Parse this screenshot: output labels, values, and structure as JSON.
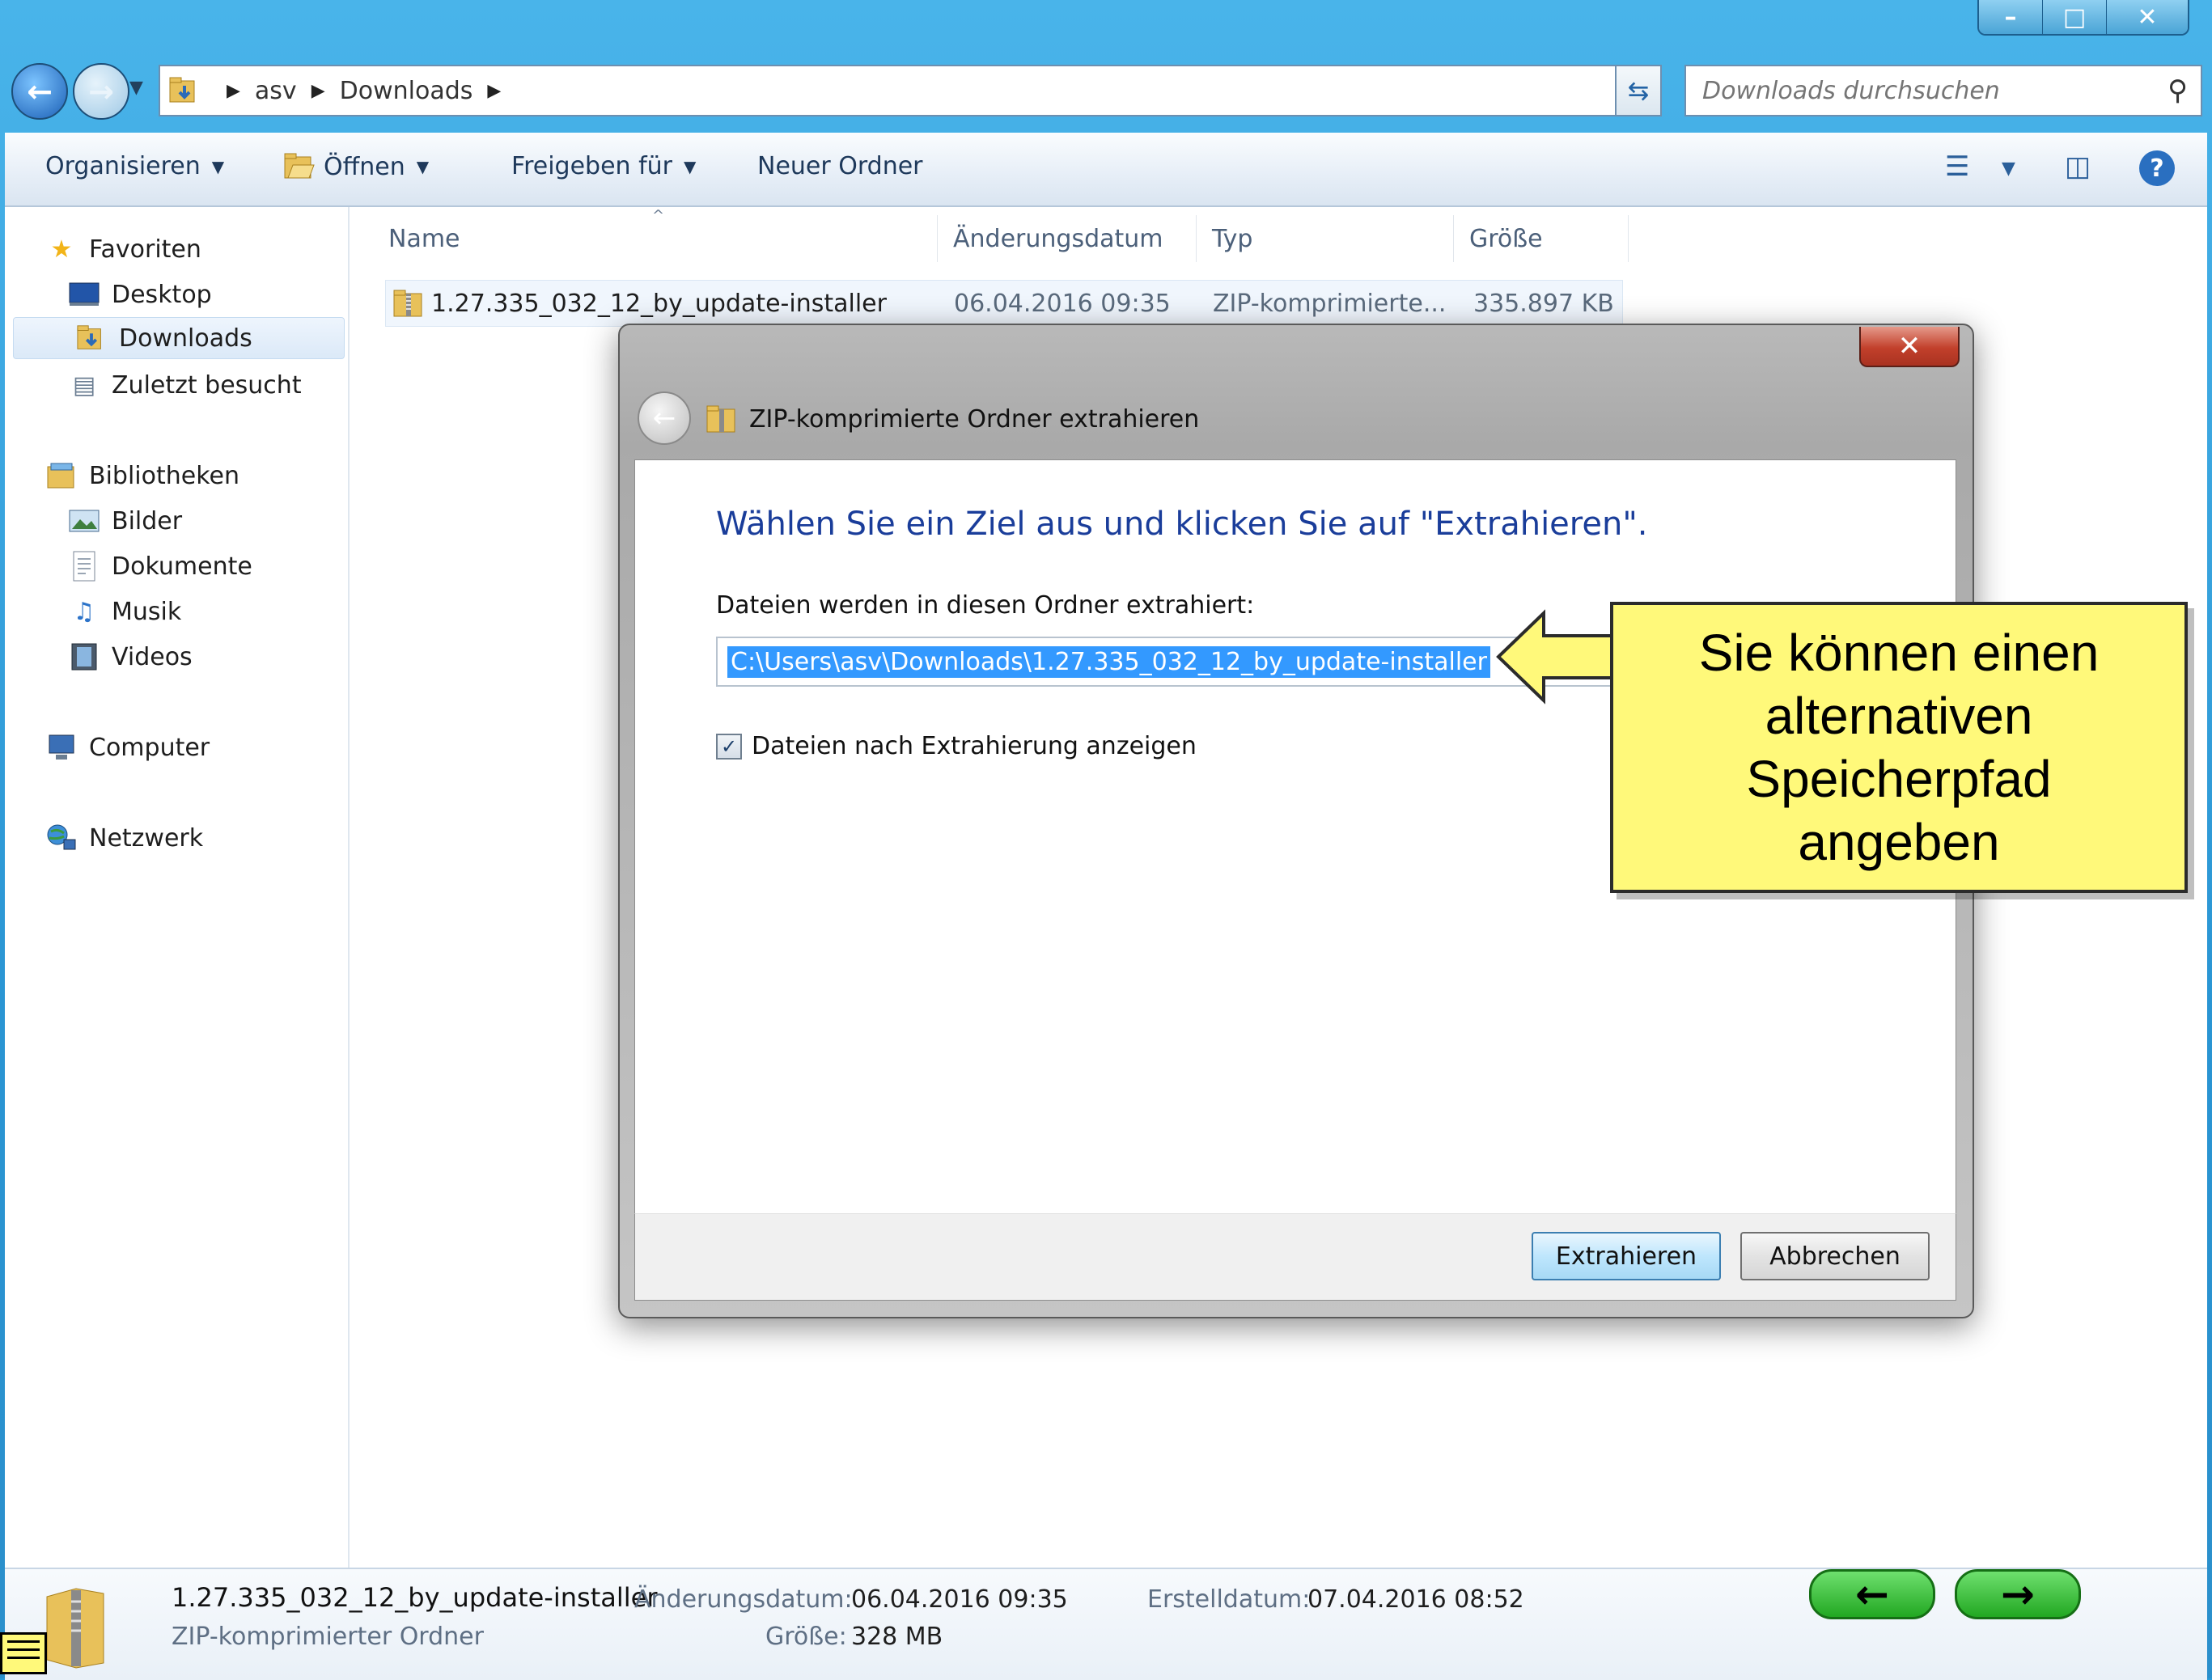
{
  "window": {
    "controls": {
      "minimize": "–",
      "maximize": "□",
      "close": "✕"
    }
  },
  "address_bar": {
    "crumbs": [
      "asv",
      "Downloads"
    ],
    "search_placeholder": "Downloads durchsuchen"
  },
  "toolbar": {
    "organize": "Organisieren",
    "open": "Öffnen",
    "share": "Freigeben für",
    "new_folder": "Neuer Ordner"
  },
  "nav": {
    "favorites": "Favoriten",
    "desktop": "Desktop",
    "downloads": "Downloads",
    "recent": "Zuletzt besucht",
    "libraries": "Bibliotheken",
    "pictures": "Bilder",
    "documents": "Dokumente",
    "music": "Musik",
    "videos": "Videos",
    "computer": "Computer",
    "network": "Netzwerk"
  },
  "columns": {
    "name": "Name",
    "date": "Änderungsdatum",
    "type": "Typ",
    "size": "Größe"
  },
  "files": [
    {
      "name": "1.27.335_032_12_by_update-installer",
      "date": "06.04.2016 09:35",
      "type": "ZIP-komprimierte...",
      "size": "335.897 KB"
    }
  ],
  "details": {
    "name": "1.27.335_032_12_by_update-installer",
    "kind": "ZIP-komprimierter Ordner",
    "modified_label": "Änderungsdatum:",
    "modified_value": "06.04.2016 09:35",
    "size_label": "Größe:",
    "size_value": "328 MB",
    "created_label": "Erstelldatum:",
    "created_value": "07.04.2016 08:52"
  },
  "dialog": {
    "title": "ZIP-komprimierte Ordner extrahieren",
    "instruction": "Wählen Sie ein Ziel aus und klicken Sie auf \"Extrahieren\".",
    "folder_label": "Dateien werden in diesen Ordner extrahiert:",
    "path": "C:\\Users\\asv\\Downloads\\1.27.335_032_12_by_update-installer",
    "show_files_label": "Dateien nach Extrahierung anzeigen",
    "show_files_checked": true,
    "extract_button": "Extrahieren",
    "cancel_button": "Abbrechen"
  },
  "callout": {
    "text": "Sie können einen alternativen Speicherpfad angeben"
  },
  "nav_buttons": {
    "prev": "←",
    "next": "→"
  },
  "colors": {
    "callout_bg": "#fff97a",
    "selection": "#3399ff",
    "title_blue": "#1a3d9a"
  }
}
